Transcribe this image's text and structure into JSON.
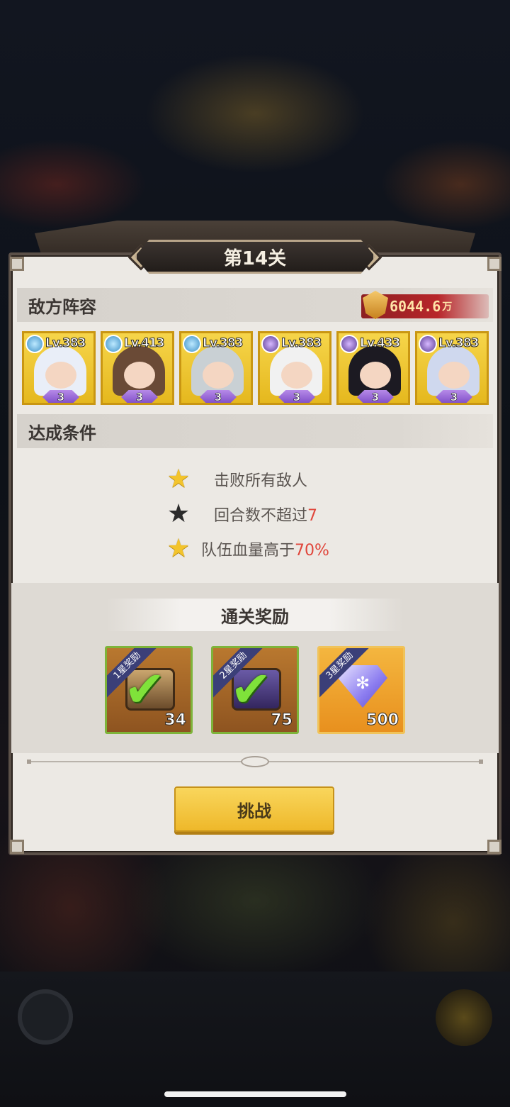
{
  "stage": {
    "title": "第14关"
  },
  "enemy": {
    "section_title": "敌方阵容",
    "power_value": "6044.6",
    "power_unit": "万",
    "units": [
      {
        "level": "Lv.383",
        "element": "light",
        "stars": "3",
        "theme": "#e9eef8"
      },
      {
        "level": "Lv.413",
        "element": "light",
        "stars": "3",
        "theme": "#6a4a36"
      },
      {
        "level": "Lv.383",
        "element": "light",
        "stars": "3",
        "theme": "#c9d0d4"
      },
      {
        "level": "Lv.383",
        "element": "dark",
        "stars": "3",
        "theme": "#f1f1f1"
      },
      {
        "level": "Lv.433",
        "element": "dark",
        "stars": "3",
        "theme": "#1c1a22"
      },
      {
        "level": "Lv.383",
        "element": "dark",
        "stars": "3",
        "theme": "#cfd8ee"
      }
    ]
  },
  "conditions": {
    "section_title": "达成条件",
    "items": [
      {
        "text": "击败所有敌人",
        "highlight": "",
        "achieved": true
      },
      {
        "text": "回合数不超过",
        "highlight": "7",
        "achieved": false
      },
      {
        "text": "队伍血量高于",
        "highlight": "70%",
        "achieved": true
      }
    ]
  },
  "rewards": {
    "section_title": "通关奖励",
    "items": [
      {
        "ribbon": "1星奖励",
        "count": "34",
        "claimed": true,
        "icon": "chest-icon"
      },
      {
        "ribbon": "2星奖励",
        "count": "75",
        "claimed": true,
        "icon": "chest-icon"
      },
      {
        "ribbon": "3星奖励",
        "count": "500",
        "claimed": false,
        "icon": "diamond-icon"
      }
    ]
  },
  "actions": {
    "challenge_label": "挑战"
  },
  "colors": {
    "accent_gold": "#f3c42c",
    "highlight_red": "#e0463b",
    "power_red": "#b8262a"
  }
}
